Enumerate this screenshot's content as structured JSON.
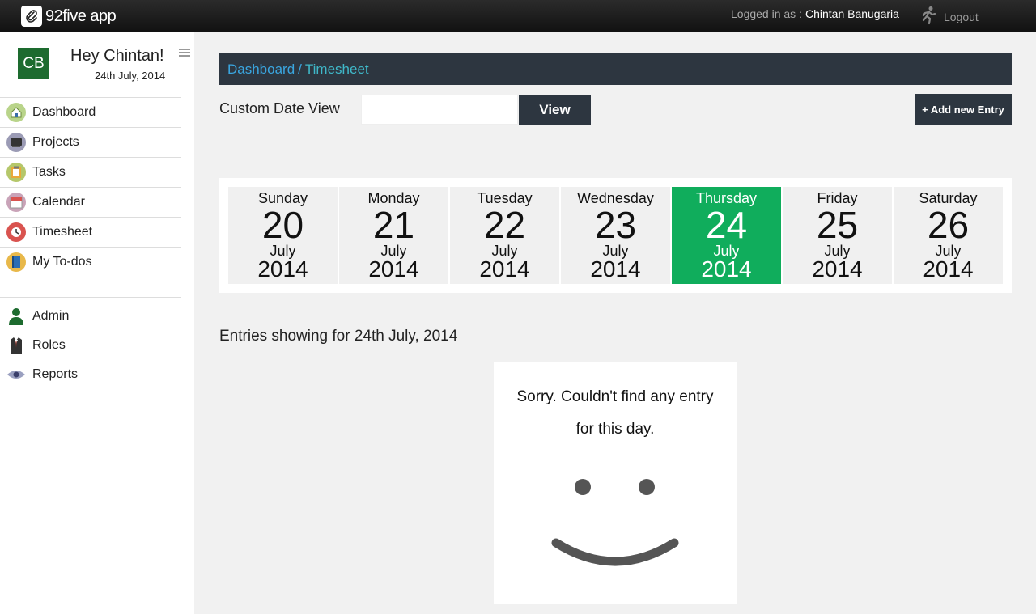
{
  "app": {
    "name": "92five app"
  },
  "topbar": {
    "logged_in_label": "Logged in as :",
    "user_name": "Chintan Banugaria",
    "logout_label": "Logout",
    "logout_icon": "running-man-icon"
  },
  "sidebar": {
    "avatar_initials": "CB",
    "greeting": "Hey Chintan!",
    "date": "24th July, 2014",
    "items": [
      {
        "label": "Dashboard",
        "icon": "home-icon"
      },
      {
        "label": "Projects",
        "icon": "projects-icon"
      },
      {
        "label": "Tasks",
        "icon": "clipboard-icon"
      },
      {
        "label": "Calendar",
        "icon": "calendar-icon"
      },
      {
        "label": "Timesheet",
        "icon": "clock-icon"
      },
      {
        "label": "My To-dos",
        "icon": "notebook-icon"
      }
    ],
    "admin_items": [
      {
        "label": "Admin",
        "icon": "user-icon"
      },
      {
        "label": "Roles",
        "icon": "suit-icon"
      },
      {
        "label": "Reports",
        "icon": "eye-icon"
      }
    ]
  },
  "breadcrumb": {
    "root": "Dashboard",
    "separator": "/",
    "current": "Timesheet"
  },
  "toolbar": {
    "custom_date_label": "Custom Date View",
    "date_input_value": "",
    "view_label": "View",
    "add_entry_label": "+ Add new Entry"
  },
  "week": {
    "days": [
      {
        "name": "Sunday",
        "num": "20",
        "month": "July",
        "year": "2014",
        "active": false
      },
      {
        "name": "Monday",
        "num": "21",
        "month": "July",
        "year": "2014",
        "active": false
      },
      {
        "name": "Tuesday",
        "num": "22",
        "month": "July",
        "year": "2014",
        "active": false
      },
      {
        "name": "Wednesday",
        "num": "23",
        "month": "July",
        "year": "2014",
        "active": false
      },
      {
        "name": "Thursday",
        "num": "24",
        "month": "July",
        "year": "2014",
        "active": true
      },
      {
        "name": "Friday",
        "num": "25",
        "month": "July",
        "year": "2014",
        "active": false
      },
      {
        "name": "Saturday",
        "num": "26",
        "month": "July",
        "year": "2014",
        "active": false
      }
    ],
    "active_color": "#10ad5c"
  },
  "entries": {
    "heading": "Entries showing for 24th July, 2014",
    "empty_message_line1": "Sorry. Couldn't find any entry",
    "empty_message_line2": "for this day."
  },
  "colors": {
    "topbar": "#1a1a1a",
    "dark_button": "#2d3640",
    "link": "#3aa6e0",
    "avatar": "#1d6b2f"
  }
}
